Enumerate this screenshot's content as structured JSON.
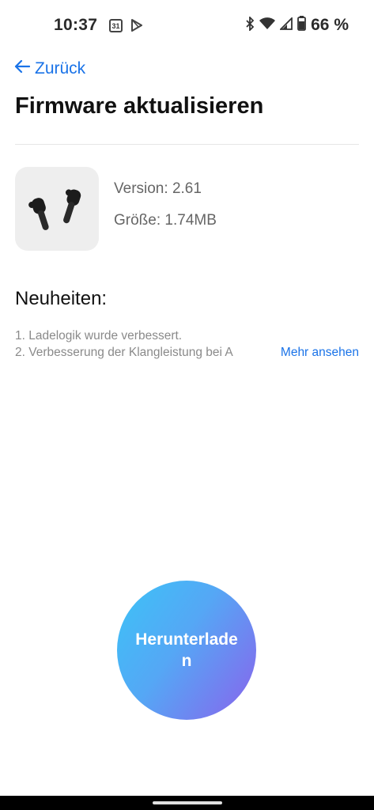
{
  "status_bar": {
    "time": "10:37",
    "calendar_day": "31",
    "battery_percent": "66 %"
  },
  "header": {
    "back_label": "Zurück",
    "title": "Firmware aktualisieren"
  },
  "firmware": {
    "version_label": "Version: ",
    "version_value": "2.61",
    "size_label": "Größe: ",
    "size_value": "1.74MB"
  },
  "news": {
    "heading": "Neuheiten:",
    "items": [
      "1. Ladelogik wurde verbessert.",
      "2. Verbesserung der Klangleistung bei A"
    ],
    "more_label": "Mehr ansehen"
  },
  "download_button_label": "Herunterladen",
  "colors": {
    "accent": "#1a73e8",
    "button_gradient_start": "#3cc3f7",
    "button_gradient_end": "#8a62ec"
  }
}
